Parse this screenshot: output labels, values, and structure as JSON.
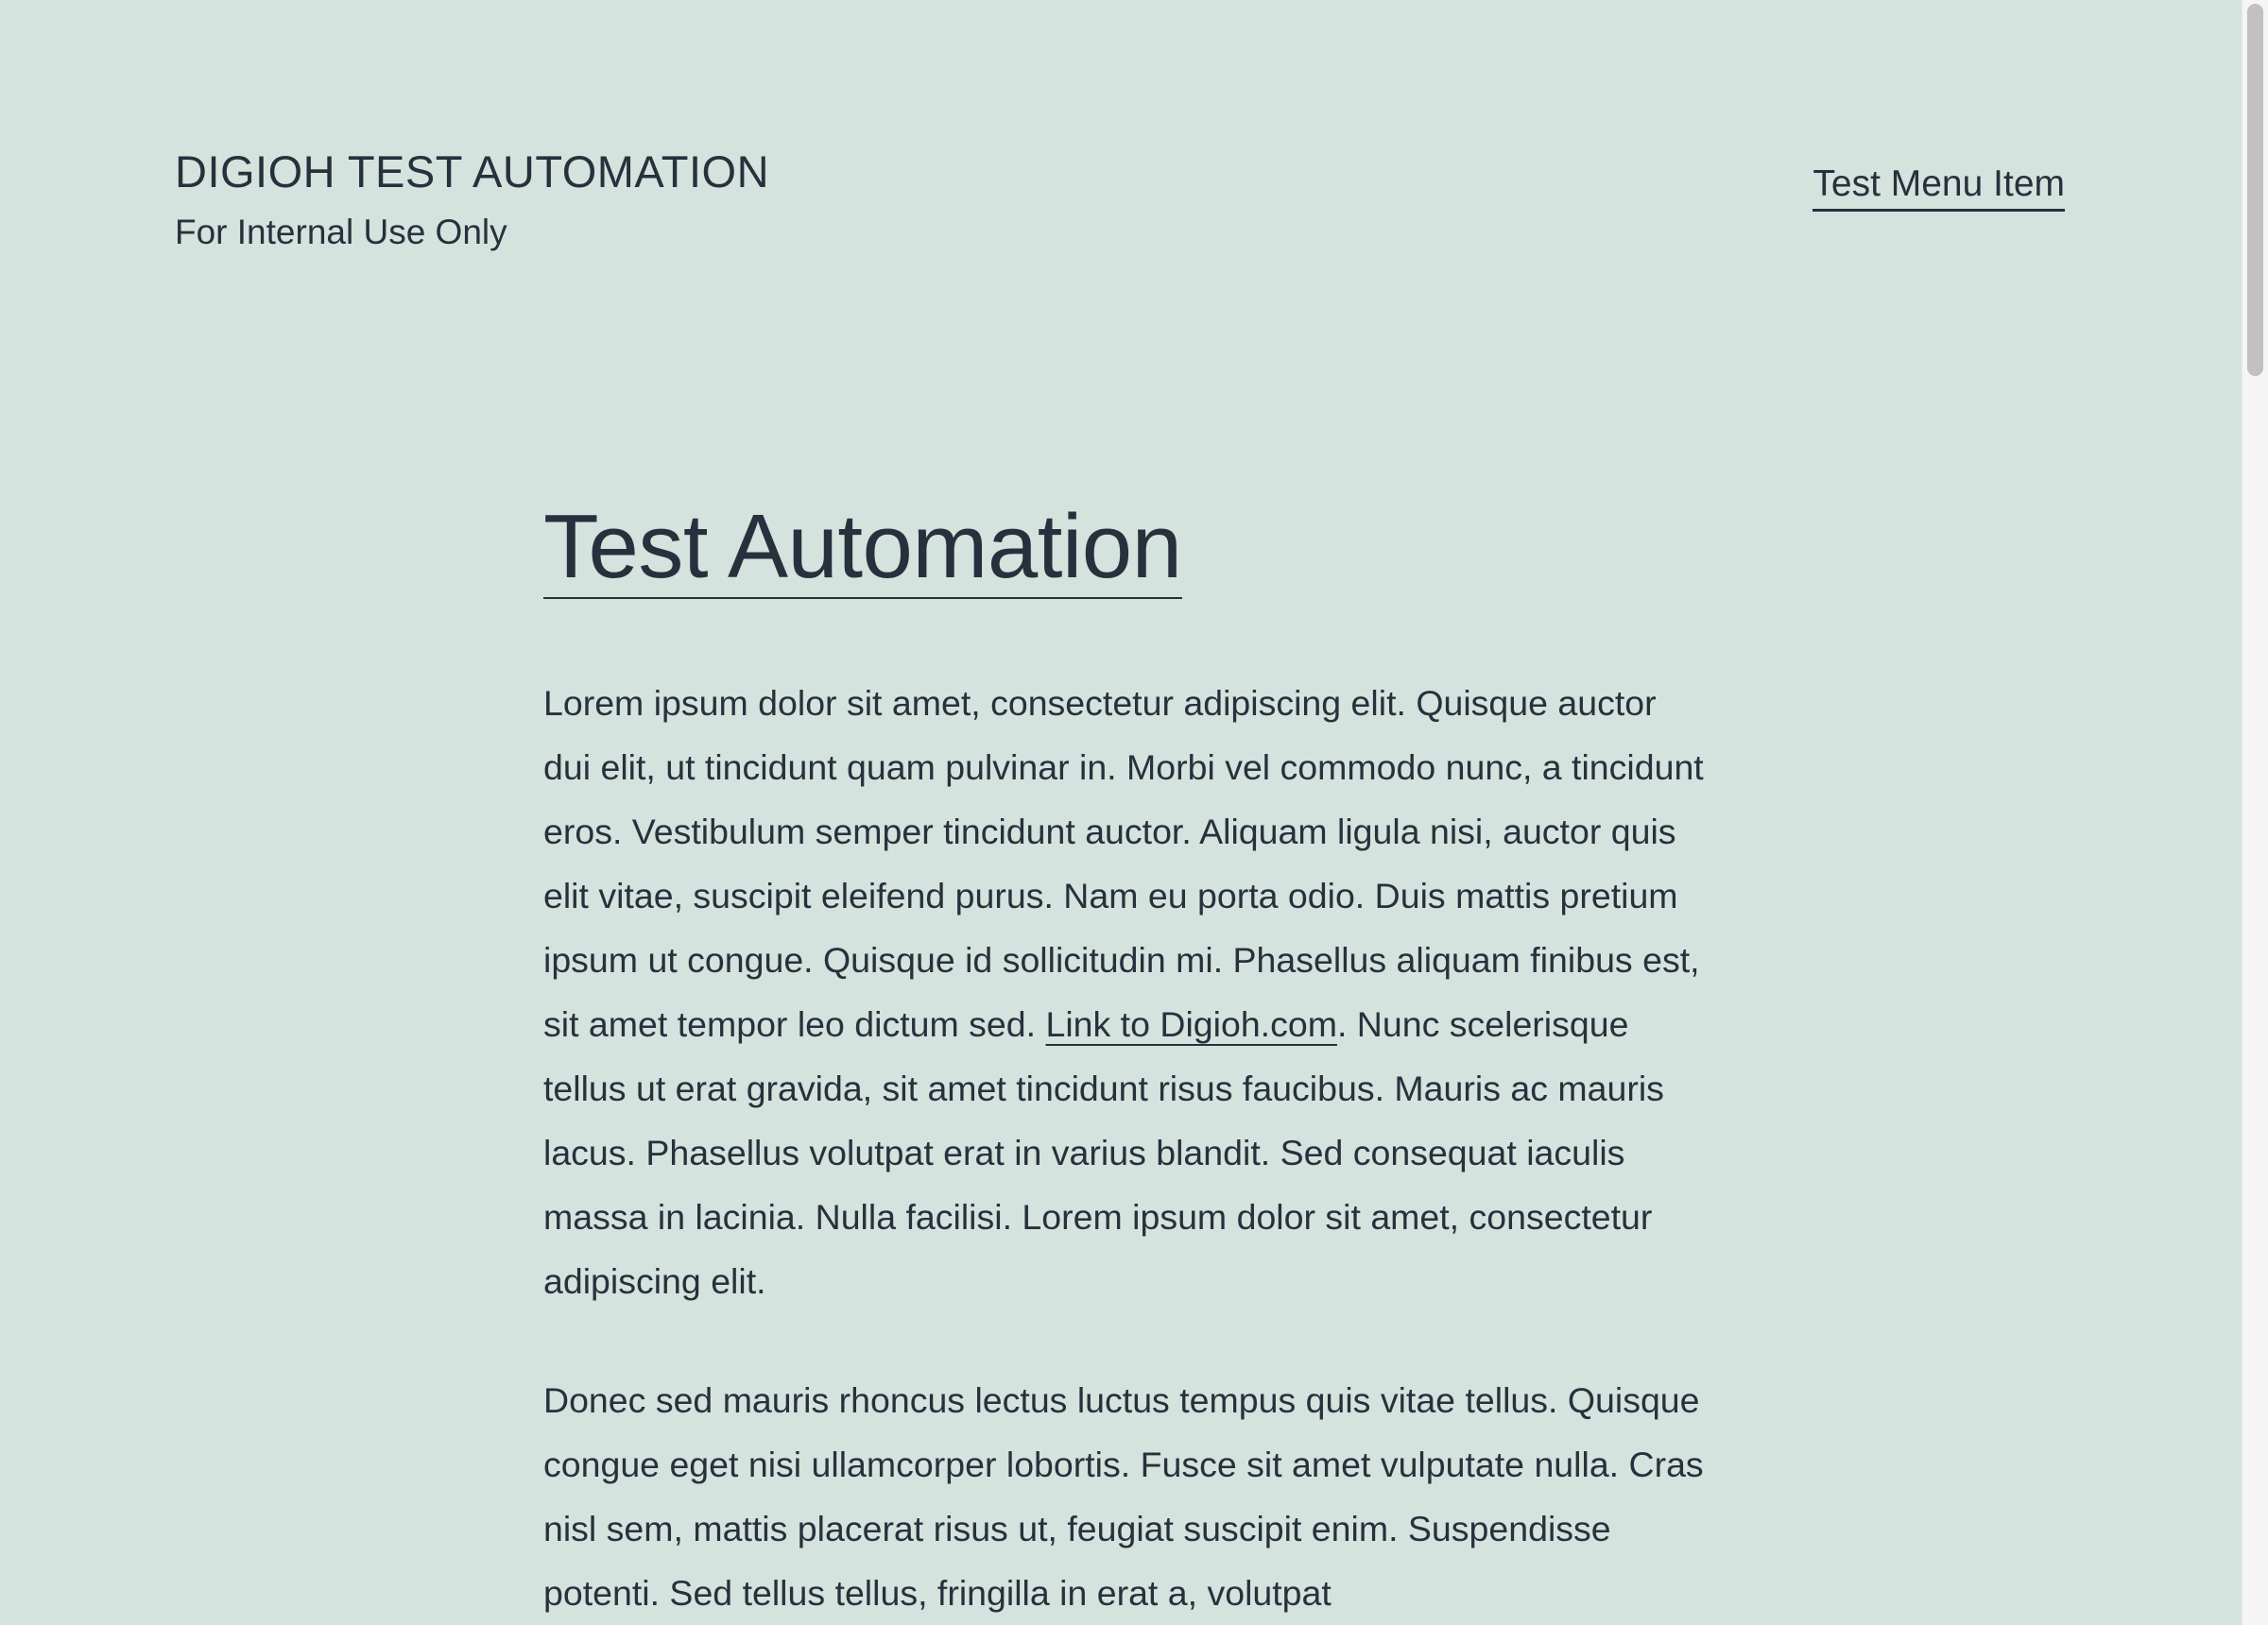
{
  "header": {
    "site_title": "DIGIOH TEST AUTOMATION",
    "site_description": "For Internal Use Only"
  },
  "menu": {
    "items": [
      {
        "label": "Test Menu Item"
      }
    ]
  },
  "post": {
    "title": "Test Automation",
    "paragraph_1": {
      "text_before_link": "Lorem ipsum dolor sit amet, consectetur adipiscing elit. Quisque auctor dui elit, ut tincidunt quam pulvinar in. Morbi vel commodo nunc, a tincidunt eros. Vestibulum semper tincidunt auctor. Aliquam ligula nisi, auctor quis elit vitae, suscipit eleifend purus. Nam eu porta odio. Duis mattis pretium ipsum ut congue. Quisque id sollicitudin mi. Phasellus aliquam finibus est, sit amet tempor leo dictum sed. ",
      "link_text": "Link to Digioh.com",
      "text_after_link": ". Nunc scelerisque tellus ut erat gravida, sit amet tincidunt risus faucibus. Mauris ac mauris lacus. Phasellus volutpat erat in varius blandit. Sed consequat iaculis massa in lacinia. Nulla facilisi. Lorem ipsum dolor sit amet, consectetur adipiscing elit."
    },
    "paragraph_2": "Donec sed mauris rhoncus lectus luctus tempus quis vitae tellus. Quisque congue eget nisi ullamcorper lobortis. Fusce sit amet vulputate nulla. Cras nisl sem, mattis placerat risus ut, feugiat suscipit enim. Suspendisse potenti. Sed tellus tellus, fringilla in erat a, volutpat"
  },
  "colors": {
    "background": "#d4e3dd",
    "text": "#28303d",
    "scrollbar_track": "#f5f5f5",
    "scrollbar_thumb": "#c1c1c1"
  }
}
